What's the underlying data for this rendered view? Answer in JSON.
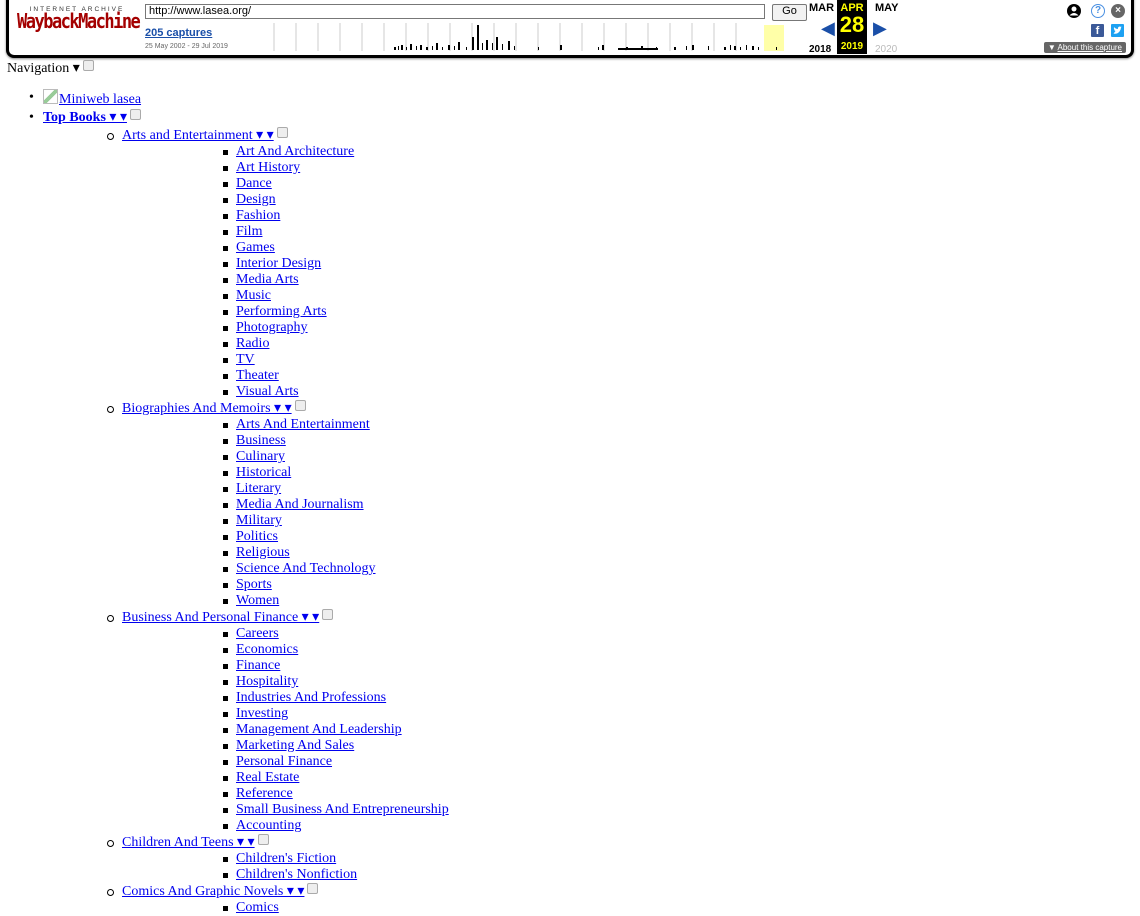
{
  "wayback": {
    "archive_label": "INTERNET ARCHIVE",
    "brand": "WaybackMachine",
    "url": "http://www.lasea.org/",
    "go_label": "Go",
    "captures": "205 captures",
    "date_range": "25 May 2002 - 29 Jul 2019",
    "months": {
      "prev": "MAR",
      "current": "APR",
      "next": "MAY"
    },
    "day": "28",
    "years": {
      "prev": "2018",
      "current": "2019",
      "next": "2020"
    },
    "about": "About this capture",
    "colors": {
      "accent": "#1a4fa8",
      "highlight": "#ffff00",
      "logo": "#a40000"
    }
  },
  "navigation_label": "Navigation ▾",
  "logo_alt": "Miniweb lasea",
  "top_books": "Top Books ▾ ▾",
  "categories": [
    {
      "label": "Arts and Entertainment ▾ ▾",
      "items": [
        "Art And Architecture",
        "Art History",
        "Dance",
        "Design",
        "Fashion",
        "Film",
        "Games",
        "Interior Design",
        "Media Arts",
        "Music",
        "Performing Arts",
        "Photography",
        "Radio",
        "TV",
        "Theater",
        "Visual Arts"
      ]
    },
    {
      "label": "Biographies And Memoirs ▾ ▾",
      "items": [
        "Arts And Entertainment",
        "Business",
        "Culinary",
        "Historical",
        "Literary",
        "Media And Journalism",
        "Military",
        "Politics",
        "Religious",
        "Science And Technology",
        "Sports",
        "Women"
      ]
    },
    {
      "label": "Business And Personal Finance ▾ ▾",
      "items": [
        "Careers",
        "Economics",
        "Finance",
        "Hospitality",
        "Industries And Professions",
        "Investing",
        "Management And Leadership",
        "Marketing And Sales",
        "Personal Finance",
        "Real Estate",
        "Reference",
        "Small Business And Entrepreneurship",
        "Accounting"
      ]
    },
    {
      "label": "Children And Teens ▾ ▾",
      "items": [
        "Children's Fiction",
        "Children's Nonfiction"
      ]
    },
    {
      "label": "Comics And Graphic Novels ▾ ▾",
      "items": [
        "Comics"
      ]
    }
  ]
}
